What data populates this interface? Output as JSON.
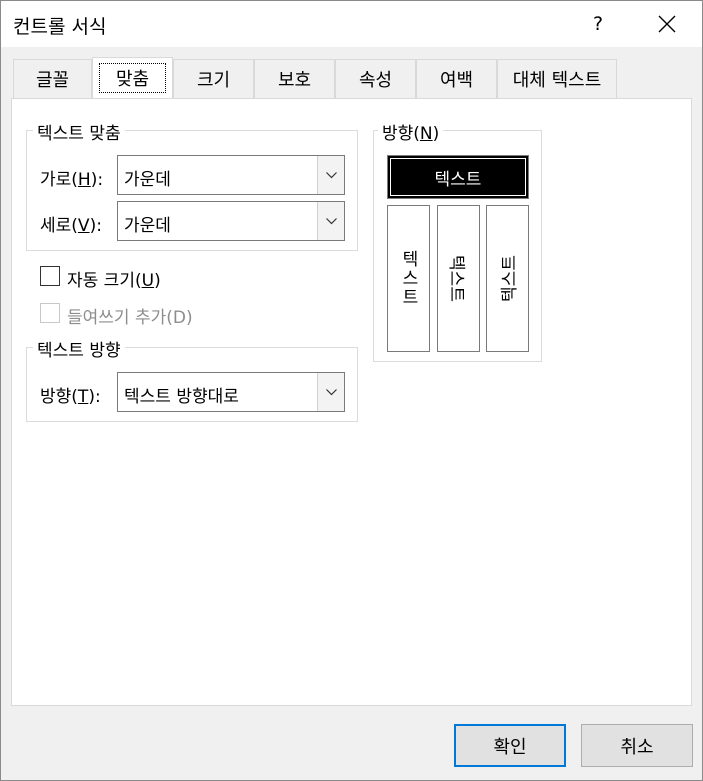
{
  "window": {
    "title": "컨트롤 서식",
    "help_label": "?"
  },
  "tabs": [
    {
      "label": "글꼴"
    },
    {
      "label": "맞춤"
    },
    {
      "label": "크기"
    },
    {
      "label": "보호"
    },
    {
      "label": "속성"
    },
    {
      "label": "여백"
    },
    {
      "label": "대체 텍스트"
    }
  ],
  "text_alignment": {
    "group_title": "텍스트 맞춤",
    "horizontal": {
      "label": "가로(",
      "key": "H",
      "suffix": "):",
      "value": "가운데"
    },
    "vertical": {
      "label": "세로(",
      "key": "V",
      "suffix": "):",
      "value": "가운데"
    }
  },
  "auto_size": {
    "label": "자동 크기(",
    "key": "U",
    "suffix": ")",
    "checked": false
  },
  "add_indent": {
    "label": "들여쓰기 추가(D)",
    "checked": false,
    "disabled": true
  },
  "text_direction": {
    "group_title": "텍스트 방향",
    "direction": {
      "label": "방향(",
      "key": "T",
      "suffix": "):",
      "value": "텍스트 방향대로"
    }
  },
  "orientation": {
    "group_title_label": "방향(",
    "group_title_key": "N",
    "group_title_suffix": ")",
    "horizontal_sample": "텍스트",
    "vertical_stacked": "텍스트",
    "rotated_up": "텍스트",
    "rotated_down": "텍스트"
  },
  "buttons": {
    "ok": "확인",
    "cancel": "취소"
  },
  "colors": {
    "accent": "#0078d7",
    "selected_orientation_bg": "#000000"
  }
}
